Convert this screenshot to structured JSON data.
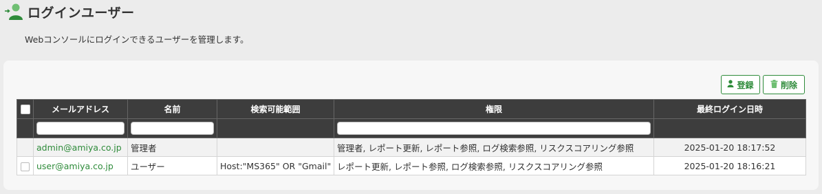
{
  "page": {
    "title": "ログインユーザー",
    "description": "Webコンソールにログインできるユーザーを管理します。",
    "icon": "user-add-icon"
  },
  "toolbar": {
    "register_label": "登録",
    "register_icon": "user-icon",
    "delete_label": "削除",
    "delete_icon": "trash-icon"
  },
  "table": {
    "columns": [
      "メールアドレス",
      "名前",
      "検索可能範囲",
      "権限",
      "最終ログイン日時"
    ],
    "rows": [
      {
        "email": "admin@amiya.co.jp",
        "name": "管理者",
        "search_scope": "",
        "permissions": "管理者, レポート更新, レポート参照, ログ検索参照, リスクスコアリング参照",
        "last_login": "2025-01-20 18:17:52"
      },
      {
        "email": "user@amiya.co.jp",
        "name": "ユーザー",
        "search_scope": "Host:\"MS365\" OR \"Gmail\"",
        "permissions": "レポート更新, レポート参照, ログ検索参照, リスクスコアリング参照",
        "last_login": "2025-01-20 18:16:21"
      }
    ]
  },
  "colors": {
    "accent": "#2e8b3a",
    "header_bg": "#3d3d3d",
    "page_bg": "#ececec"
  }
}
